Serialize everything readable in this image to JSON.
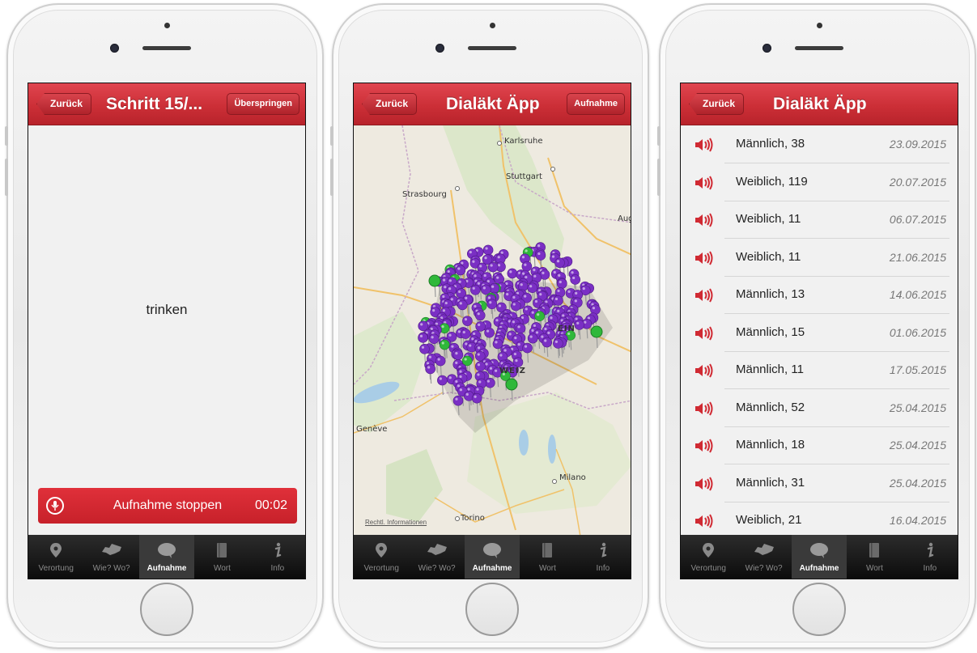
{
  "colors": {
    "accent": "#cc2f37",
    "pin_purple": "#7a2fc4",
    "pin_green": "#2fb83a"
  },
  "tabs": [
    {
      "label": "Verortung",
      "icon": "location-pin-icon"
    },
    {
      "label": "Wie? Wo?",
      "icon": "switzerland-map-icon"
    },
    {
      "label": "Aufnahme",
      "icon": "speech-bubble-icon"
    },
    {
      "label": "Wort",
      "icon": "book-icon"
    },
    {
      "label": "Info",
      "icon": "info-icon"
    }
  ],
  "screen1": {
    "back": "Zurück",
    "title": "Schritt 15/...",
    "right": "Überspringen",
    "word": "trinken",
    "record_label": "Aufnahme stoppen",
    "record_time": "00:02"
  },
  "screen2": {
    "back": "Zurück",
    "title": "Dialäkt Äpp",
    "right": "Aufnahme",
    "cities": {
      "karlsruhe": "Karlsruhe",
      "stuttgart": "Stuttgart",
      "strasbourg": "Strasbourg",
      "aug": "Aug",
      "geneve": "Genève",
      "milano": "Milano",
      "torino": "Torino",
      "ein": "EIN",
      "weiz": "WEIZ"
    },
    "legal": "Rechtl. Informationen"
  },
  "screen3": {
    "back": "Zurück",
    "title": "Dialäkt Äpp",
    "recordings": [
      {
        "name": "Männlich, 38",
        "date": "23.09.2015"
      },
      {
        "name": "Weiblich, 119",
        "date": "20.07.2015"
      },
      {
        "name": "Weiblich, 11",
        "date": "06.07.2015"
      },
      {
        "name": "Weiblich, 11",
        "date": "21.06.2015"
      },
      {
        "name": "Männlich, 13",
        "date": "14.06.2015"
      },
      {
        "name": "Männlich, 15",
        "date": "01.06.2015"
      },
      {
        "name": "Männlich, 11",
        "date": "17.05.2015"
      },
      {
        "name": "Männlich, 52",
        "date": "25.04.2015"
      },
      {
        "name": "Männlich, 18",
        "date": "25.04.2015"
      },
      {
        "name": "Männlich, 31",
        "date": "25.04.2015"
      },
      {
        "name": "Weiblich, 21",
        "date": "16.04.2015"
      }
    ]
  }
}
